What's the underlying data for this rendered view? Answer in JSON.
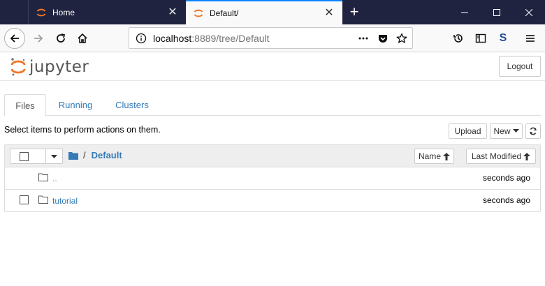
{
  "browser": {
    "tabs": [
      {
        "title": "Home",
        "active": false
      },
      {
        "title": "Default/",
        "active": true
      }
    ],
    "url_host": "localhost",
    "url_rest": ":8889/tree/Default",
    "colors": {
      "titlebar": "#202340",
      "tab_accent": "#0a84ff",
      "favicon": "#f37626"
    }
  },
  "jupyter": {
    "logo_text": "jupyter",
    "logout_label": "Logout",
    "tabs": [
      {
        "label": "Files"
      },
      {
        "label": "Running"
      },
      {
        "label": "Clusters"
      }
    ],
    "toolbar": {
      "hint": "Select items to perform actions on them.",
      "upload_label": "Upload",
      "new_label": "New"
    },
    "breadcrumb": {
      "separator": "/",
      "current": "Default"
    },
    "sort": {
      "name_label": "Name",
      "modified_label": "Last Modified"
    },
    "files": [
      {
        "name": "..",
        "modified": "seconds ago",
        "selectable": false
      },
      {
        "name": "tutorial",
        "modified": "seconds ago",
        "selectable": true
      }
    ],
    "colors": {
      "link": "#337ab7"
    }
  }
}
